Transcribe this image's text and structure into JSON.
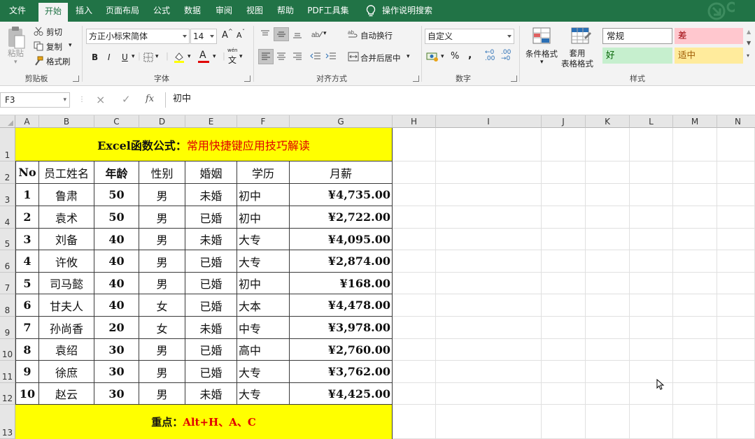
{
  "ribbon_tabs": [
    "文件",
    "开始",
    "插入",
    "页面布局",
    "公式",
    "数据",
    "审阅",
    "视图",
    "帮助",
    "PDF工具集"
  ],
  "active_tab": "开始",
  "tell_me": "操作说明搜索",
  "clipboard": {
    "paste": "粘贴",
    "cut": "剪切",
    "copy": "复制",
    "format_painter": "格式刷",
    "label": "剪贴板"
  },
  "font": {
    "name": "方正小标宋简体",
    "size": "14",
    "bold": "B",
    "italic": "I",
    "underline": "U",
    "grow": "A",
    "shrink": "A",
    "font_color_letter": "A",
    "phonetic": "wén",
    "label": "字体"
  },
  "alignment": {
    "wrap_text": "自动换行",
    "merge_center": "合并后居中",
    "label": "对齐方式"
  },
  "number": {
    "format": "自定义",
    "percent": "%",
    "comma": ",",
    "label": "数字"
  },
  "styles": {
    "conditional": "条件格式",
    "table_format": "套用\n表格格式",
    "normal": "常规",
    "bad": "差",
    "good": "好",
    "neutral": "适中",
    "label": "样式"
  },
  "formula_bar": {
    "name_box": "F3",
    "cancel": "×",
    "enter": "✓",
    "fx": "fx",
    "content": "初中"
  },
  "columns": [
    "A",
    "B",
    "C",
    "D",
    "E",
    "F",
    "G",
    "H",
    "I",
    "J",
    "K",
    "L",
    "M",
    "N"
  ],
  "rows": [
    "1",
    "2",
    "3",
    "4",
    "5",
    "6",
    "7",
    "8",
    "9",
    "10",
    "11",
    "12",
    "13"
  ],
  "sheet": {
    "title_black": "Excel函数公式：",
    "title_red": "常用快捷键应用技巧解读",
    "headers": [
      "No",
      "员工姓名",
      "年龄",
      "性别",
      "婚姻",
      "学历",
      "月薪"
    ],
    "data": [
      [
        "1",
        "鲁肃",
        "50",
        "男",
        "未婚",
        "初中",
        "¥4,735.00"
      ],
      [
        "2",
        "袁术",
        "50",
        "男",
        "已婚",
        "初中",
        "¥2,722.00"
      ],
      [
        "3",
        "刘备",
        "40",
        "男",
        "未婚",
        "大专",
        "¥4,095.00"
      ],
      [
        "4",
        "许攸",
        "40",
        "男",
        "已婚",
        "大专",
        "¥2,874.00"
      ],
      [
        "5",
        "司马懿",
        "40",
        "男",
        "已婚",
        "初中",
        "¥168.00"
      ],
      [
        "6",
        "甘夫人",
        "40",
        "女",
        "已婚",
        "大本",
        "¥4,478.00"
      ],
      [
        "7",
        "孙尚香",
        "20",
        "女",
        "未婚",
        "中专",
        "¥3,978.00"
      ],
      [
        "8",
        "袁绍",
        "30",
        "男",
        "已婚",
        "高中",
        "¥2,760.00"
      ],
      [
        "9",
        "徐庶",
        "30",
        "男",
        "已婚",
        "大专",
        "¥3,762.00"
      ],
      [
        "10",
        "赵云",
        "30",
        "男",
        "未婚",
        "大专",
        "¥4,425.00"
      ]
    ],
    "footer_black": "重点：",
    "footer_red": "Alt+H、A、C"
  },
  "colors": {
    "ribbon_green": "#217346",
    "highlight_yellow": "#ffff00",
    "accent_red": "#e00000",
    "bad_bg": "#ffc7ce",
    "good_bg": "#c6efce",
    "neutral_bg": "#ffeb9c"
  }
}
